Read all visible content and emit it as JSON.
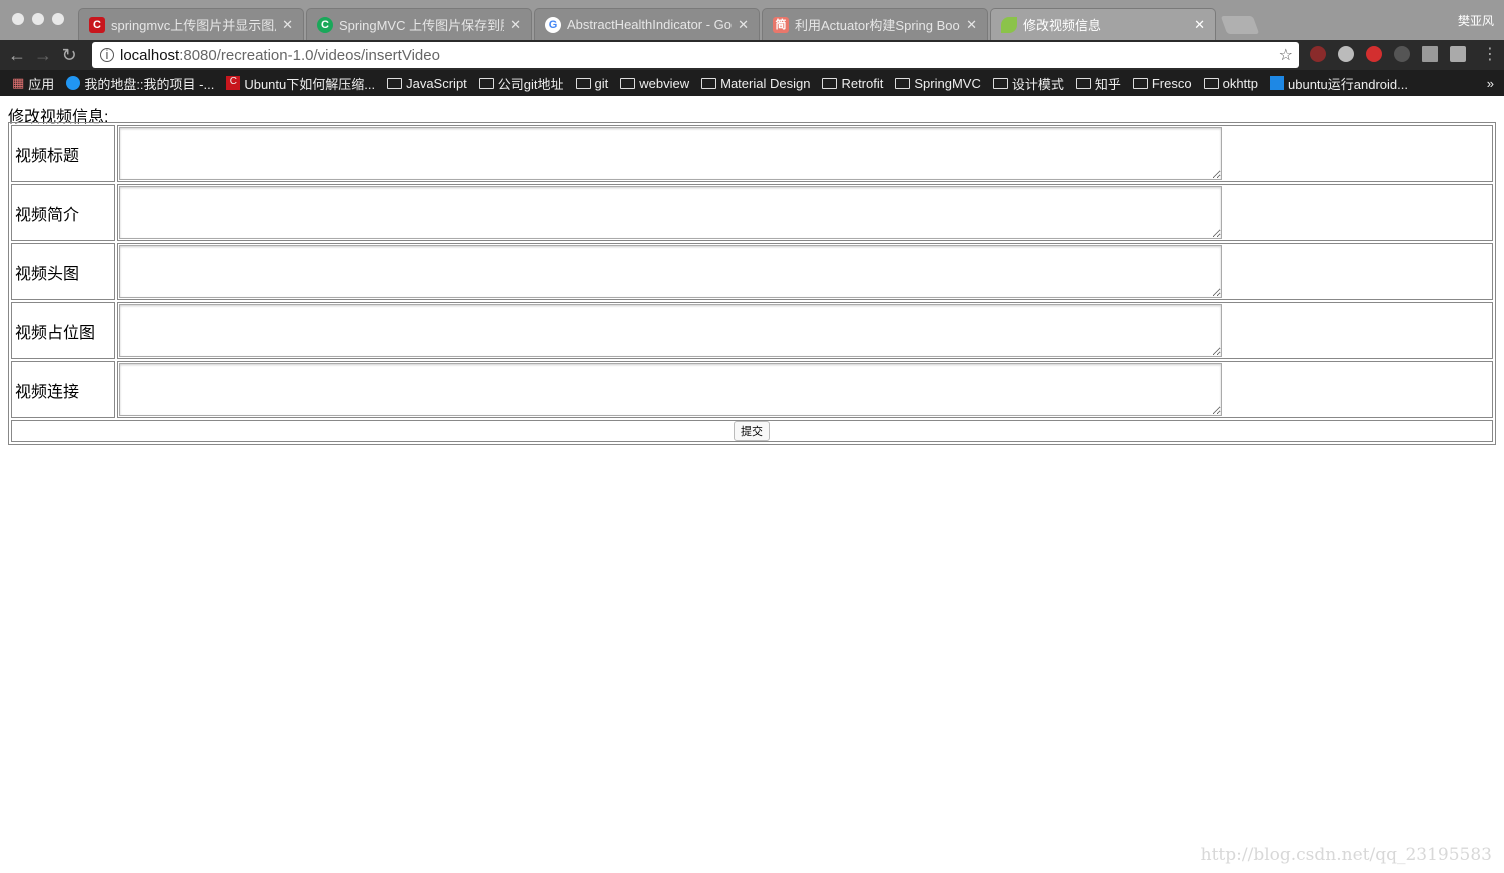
{
  "browser": {
    "tabs": [
      {
        "title": "springmvc上传图片并显示图片-",
        "icon": "csdn-icon",
        "color": "#c8161d"
      },
      {
        "title": "SpringMVC 上传图片保存到服务",
        "icon": "green-c-icon",
        "color": "#1aa85a"
      },
      {
        "title": "AbstractHealthIndicator - Goo",
        "icon": "google-icon",
        "color": "#ffffff"
      },
      {
        "title": "利用Actuator构建Spring Boot",
        "icon": "jianshu-icon",
        "color": "#e9776b"
      },
      {
        "title": "修改视频信息",
        "icon": "spring-leaf-icon",
        "color": "#8bc34a"
      }
    ],
    "user": "樊亚风",
    "url_host": "localhost",
    "url_rest": ":8080/recreation-1.0/videos/insertVideo",
    "bookmarks": [
      "应用",
      "我的地盘::我的项目 -...",
      "Ubuntu下如何解压缩...",
      "JavaScript",
      "公司git地址",
      "git",
      "webview",
      "Material Design",
      "Retrofit",
      "SpringMVC",
      "设计模式",
      "知乎",
      "Fresco",
      "okhttp",
      "ubuntu运行android..."
    ],
    "more": "»"
  },
  "page": {
    "heading": "修改视频信息:",
    "fields": [
      "视频标题",
      "视频简介",
      "视频头图",
      "视频占位图",
      "视频连接"
    ],
    "submit": "提交"
  },
  "watermark": "http://blog.csdn.net/qq_23195583"
}
